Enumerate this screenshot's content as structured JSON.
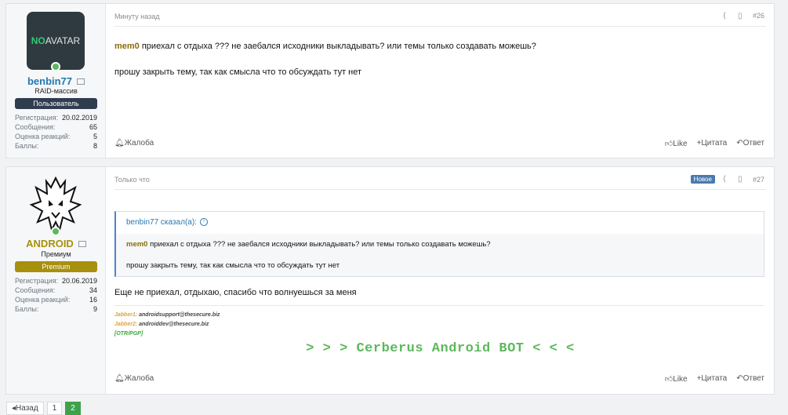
{
  "post1": {
    "user": {
      "avatar_text_no": "NO",
      "avatar_text_rest": " AVATAR",
      "name": "benbin77",
      "title": "RAID-массив",
      "banner": "Пользователь",
      "banner_color": "#2f3d4f",
      "stats": [
        {
          "k": "Регистрация:",
          "v": "20.02.2019"
        },
        {
          "k": "Сообщения:",
          "v": "65"
        },
        {
          "k": "Оценка реакций:",
          "v": "5"
        },
        {
          "k": "Баллы:",
          "v": "8"
        }
      ]
    },
    "time": "Минуту назад",
    "number": "#26",
    "mention": "mem0",
    "line1_rest": " приехал с отдыха ??? не заебался исходники выкладывать? или темы только создавать можешь?",
    "line2": "прошу закрыть тему, так как смысла что то обсуждать тут нет",
    "report": "Жалоба",
    "actions": {
      "like": "Like",
      "quote": "Цитата",
      "reply": "Ответ"
    }
  },
  "post2": {
    "user": {
      "name": "ANDROID",
      "title": "Премиум",
      "banner": "Premium",
      "banner_color": "#a8900f",
      "name_color": "#a8900f",
      "stats": [
        {
          "k": "Регистрация:",
          "v": "20.06.2019"
        },
        {
          "k": "Сообщения:",
          "v": "34"
        },
        {
          "k": "Оценка реакций:",
          "v": "16"
        },
        {
          "k": "Баллы:",
          "v": "9"
        }
      ]
    },
    "time": "Только что",
    "badge": "Новое",
    "number": "#27",
    "quote": {
      "author": "benbin77 сказал(а):",
      "mention": "mem0",
      "line1_rest": " приехал с отдыха ??? не заебался исходники выкладывать? или темы только создавать можешь?",
      "line2": "прошу закрыть тему, так как смысла что то обсуждать тут нет"
    },
    "text": "Еще не приехал, отдыхаю, спасибо что волнуешься за меня",
    "signature": {
      "j1k": "Jabber1:",
      "j1v": " androidsupport@thesecure.biz",
      "j2k": "Jabber2:",
      "j2v": " androiddev@thesecure.biz",
      "otr": "[OTR/PGP]",
      "banner": "> > > Cerberus Android BOT < < <"
    },
    "report": "Жалоба",
    "actions": {
      "like": "Like",
      "quote": "Цитата",
      "reply": "Ответ"
    }
  },
  "pager": {
    "prev": "Назад",
    "pages": [
      "1",
      "2"
    ],
    "current": "2"
  }
}
